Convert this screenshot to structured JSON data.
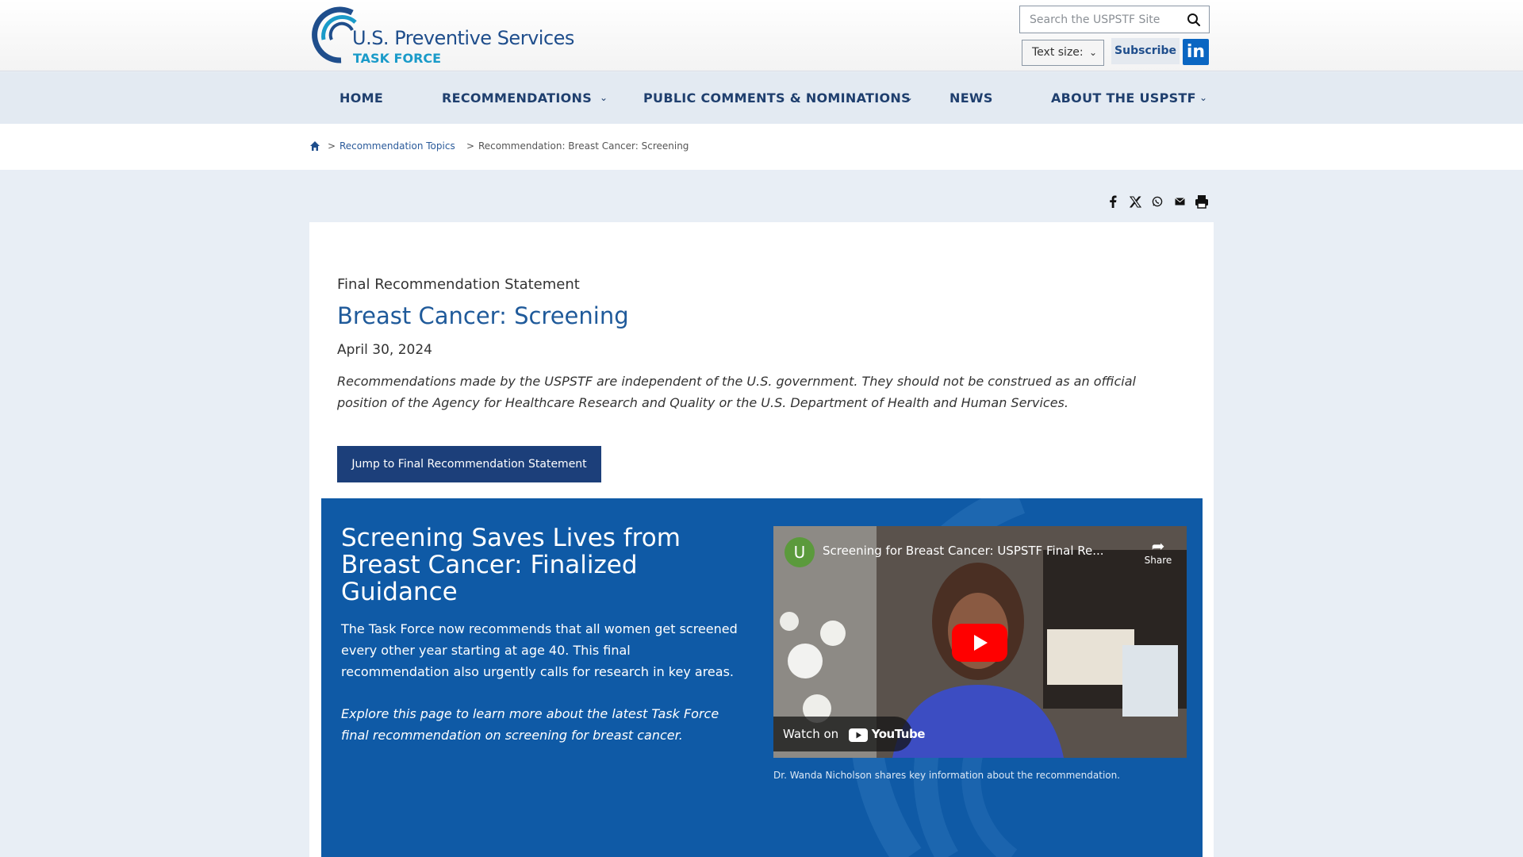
{
  "header": {
    "logo_line1": "U.S. Preventive Services",
    "logo_line2": "TASK FORCE",
    "search_placeholder": "Search the USPSTF Site",
    "text_size_label": "Text size:",
    "subscribe_label": "Subscribe",
    "linkedin_label": "in"
  },
  "nav": {
    "items": [
      {
        "label": "HOME",
        "has_dropdown": false
      },
      {
        "label": "RECOMMENDATIONS",
        "has_dropdown": true
      },
      {
        "label": "PUBLIC COMMENTS & NOMINATIONS",
        "has_dropdown": true
      },
      {
        "label": "NEWS",
        "has_dropdown": false
      },
      {
        "label": "ABOUT THE USPSTF",
        "has_dropdown": true
      }
    ]
  },
  "breadcrumb": {
    "separator": ">",
    "items": [
      "Recommendation Topics",
      "Recommendation: Breast Cancer: Screening"
    ]
  },
  "share_icons": [
    "facebook-icon",
    "x-icon",
    "whatsapp-icon",
    "email-icon",
    "print-icon"
  ],
  "main": {
    "eyebrow": "Final Recommendation Statement",
    "title": "Breast Cancer: Screening",
    "date": "April 30, 2024",
    "disclaimer": "Recommendations made by the USPSTF are independent of the U.S. government. They should not be construed as an official position of the Agency for Healthcare Research and Quality or the U.S. Department of Health and Human Services.",
    "jump_button": "Jump to Final Recommendation Statement"
  },
  "feature": {
    "title": "Screening Saves Lives from Breast Cancer: Finalized Guidance",
    "body": "The Task Force now recommends that all women get screened every other year starting at age 40. This final recommendation also urgently calls for research in key areas.",
    "explore": "Explore this page to learn more about the latest Task Force final recommendation on screening for breast cancer.",
    "video": {
      "channel_initial": "U",
      "title": "Screening for Breast Cancer: USPSTF Final Re...",
      "share_label": "Share",
      "watch_on": "Watch on",
      "youtube_label": "YouTube"
    },
    "caption": "Dr. Wanda Nicholson shares key information about the recommendation."
  },
  "colors": {
    "brand_navy": "#1f4e8c",
    "brand_teal": "#1a9bc9",
    "feature_blue": "#0f5aa6",
    "button_navy": "#1c3f7a"
  }
}
